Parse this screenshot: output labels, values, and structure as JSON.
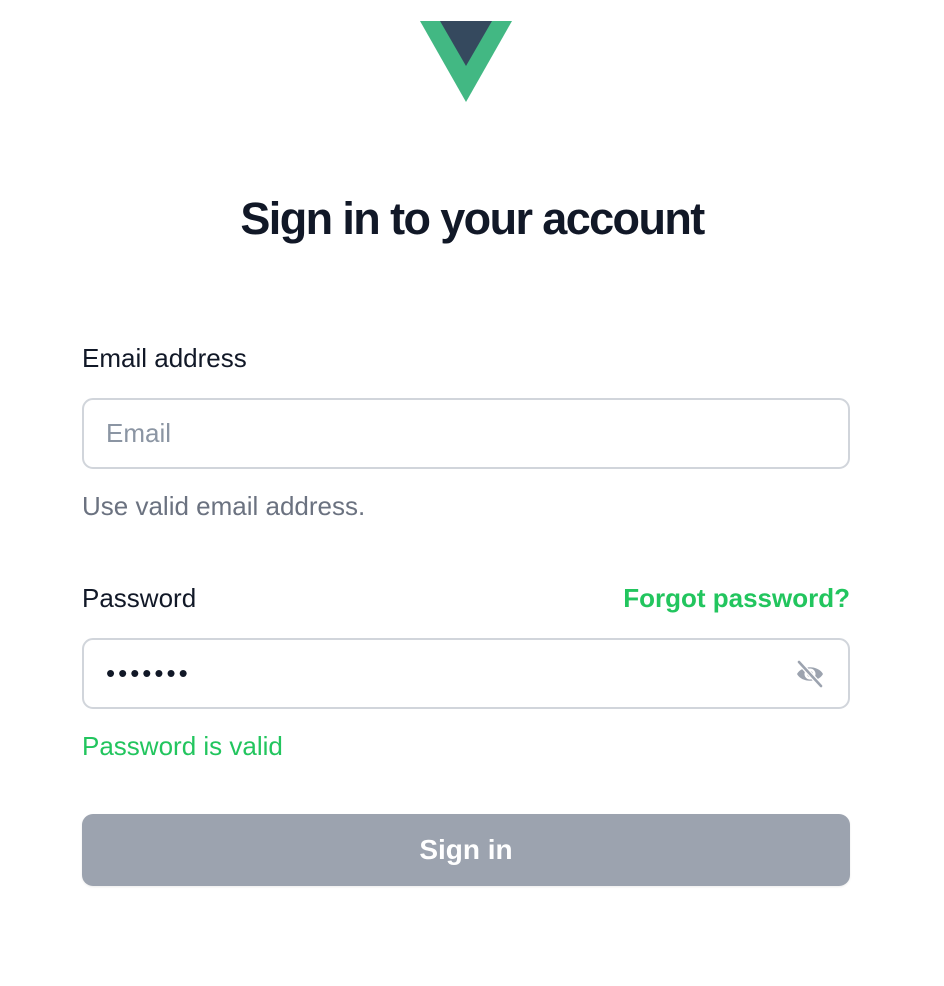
{
  "logo": {
    "icon": "vue-logo-icon",
    "colors": {
      "outer": "#42b883",
      "inner": "#35495e"
    }
  },
  "title": "Sign in to your account",
  "email": {
    "label": "Email address",
    "placeholder": "Email",
    "value": "",
    "hint": "Use valid email address."
  },
  "password": {
    "label": "Password",
    "forgot_link": "Forgot password?",
    "value": "•••••••",
    "toggle_icon": "eye-slash-icon",
    "status": "Password is valid"
  },
  "submit": {
    "label": "Sign in",
    "color": "#9ca3af"
  },
  "colors": {
    "accent": "#22c55e",
    "text": "#111827",
    "muted": "#6b7280",
    "border": "#d1d5db"
  }
}
